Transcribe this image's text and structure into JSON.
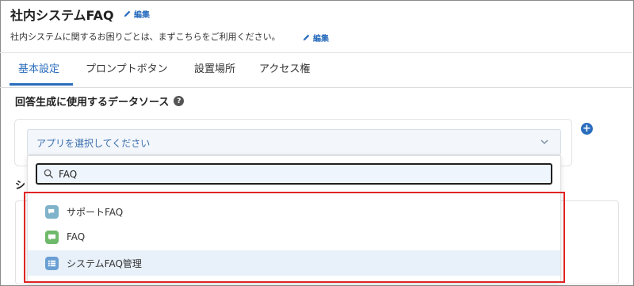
{
  "header": {
    "title": "社内システムFAQ",
    "edit_label": "編集",
    "description": "社内システムに関するお困りごとは、まずこちらをご利用ください。",
    "description_edit_label": "編集"
  },
  "tabs": [
    {
      "label": "基本設定",
      "active": true
    },
    {
      "label": "プロンプトボタン",
      "active": false
    },
    {
      "label": "設置場所",
      "active": false
    },
    {
      "label": "アクセス権",
      "active": false
    }
  ],
  "data_source": {
    "section_title": "回答生成に使用するデータソース",
    "help_icon": "question-circle-icon",
    "add_icon": "plus-circle-icon",
    "select_placeholder": "アプリを選択してください",
    "chevron_icon": "chevron-down-icon"
  },
  "background_section": {
    "label_partial": "シ"
  },
  "dropdown": {
    "search_value": "FAQ",
    "search_icon": "search-icon",
    "options": [
      {
        "label": "サポートFAQ",
        "icon": "chat-bubbles-icon",
        "icon_color": "#7fb3c9",
        "selected": false
      },
      {
        "label": "FAQ",
        "icon": "chat-bubble-icon",
        "icon_color": "#6fb96a",
        "selected": false
      },
      {
        "label": "システムFAQ管理",
        "icon": "list-icon",
        "icon_color": "#6a9fd4",
        "selected": true
      }
    ]
  },
  "colors": {
    "accent": "#2a6dbd",
    "highlight_border": "#e02424",
    "selected_row": "#e8f1fa"
  }
}
